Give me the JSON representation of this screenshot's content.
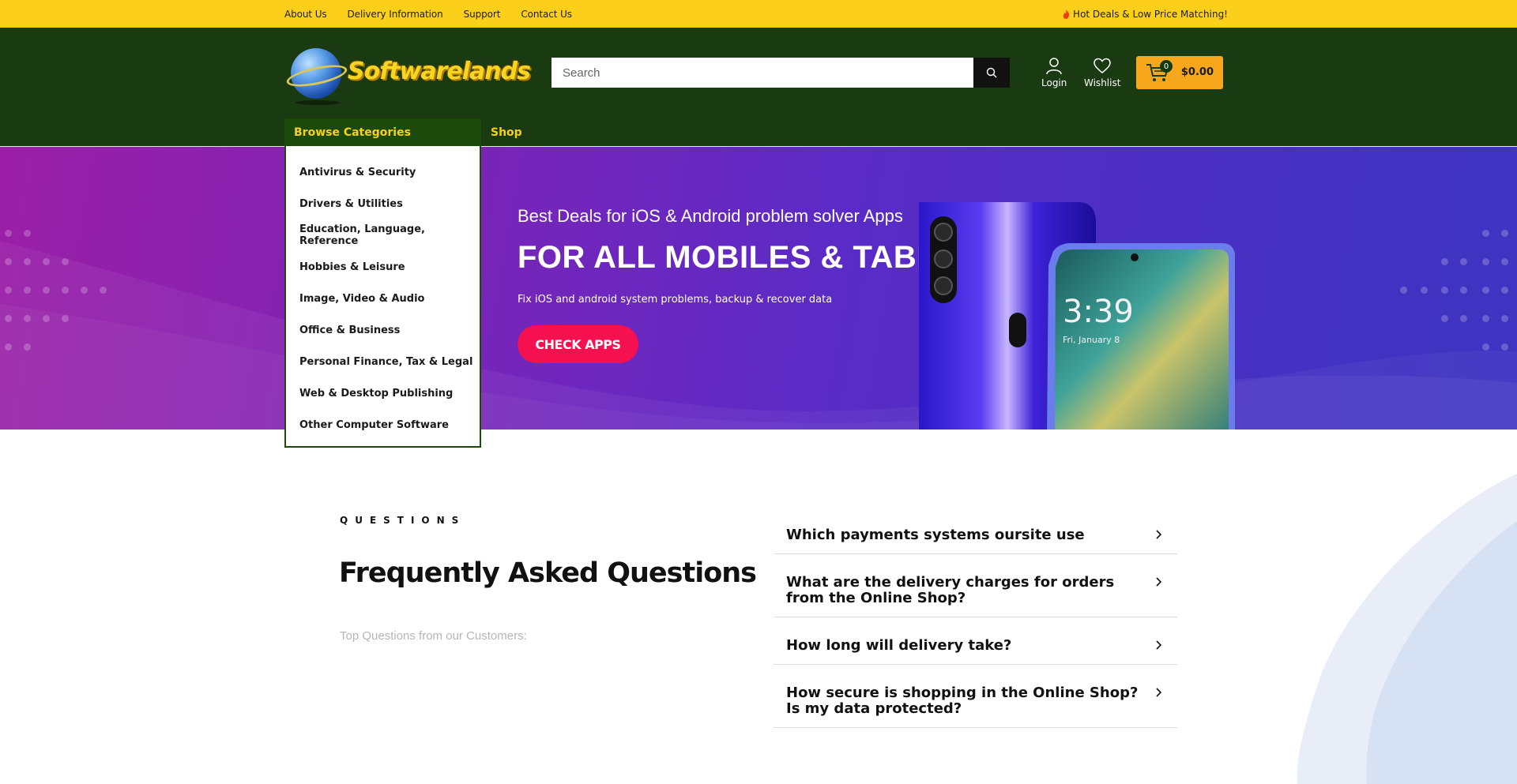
{
  "topbar": {
    "links": [
      "About Us",
      "Delivery Information",
      "Support",
      "Contact Us"
    ],
    "promo": "Hot Deals & Low Price Matching!"
  },
  "header": {
    "logo_text": "Softwarelands",
    "search_placeholder": "Search",
    "login_label": "Login",
    "wishlist_label": "Wishlist",
    "cart_count": "0",
    "cart_total": "$0.00"
  },
  "nav": {
    "browse_label": "Browse Categories",
    "shop_label": "Shop"
  },
  "categories": [
    "Antivirus & Security",
    "Drivers & Utilities",
    "Education, Language, Reference",
    "Hobbies & Leisure",
    "Image, Video & Audio",
    "Office & Business",
    "Personal Finance, Tax & Legal",
    "Web & Desktop Publishing",
    "Other Computer Software"
  ],
  "hero": {
    "subtitle": "Best Deals for iOS & Android problem solver Apps",
    "title": "FOR ALL MOBILES & TABLETS",
    "description": "Fix iOS and android system problems, backup & recover data",
    "button": "CHECK APPS",
    "phone_time": "3:39",
    "phone_date": "Fri, January 8"
  },
  "faq": {
    "kicker": "QUESTIONS",
    "title": "Frequently Asked Questions",
    "subtitle": "Top Questions from our Customers:",
    "items": [
      "Which payments systems oursite use",
      "What are the delivery charges for orders from the Online Shop?",
      "How long will delivery take?",
      "How secure is shopping in the Online Shop? Is my data protected?"
    ]
  },
  "colors": {
    "topbar": "#fccf1a",
    "header": "#1a3a12",
    "browse": "#1c4a0b",
    "accent_yellow": "#f8d01c",
    "cart": "#f7a71b",
    "hero_button": "#f5104f"
  }
}
